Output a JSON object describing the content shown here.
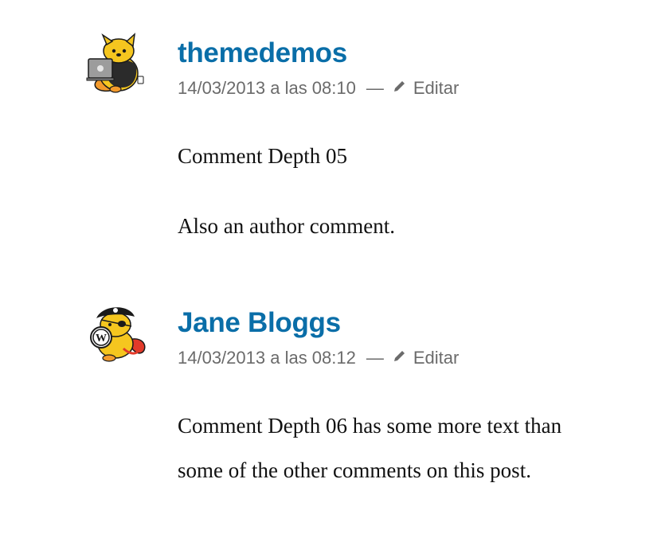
{
  "comments": [
    {
      "author": "themedemos",
      "date": "14/03/2013 a las 08:10",
      "separator": "—",
      "edit_label": "Editar",
      "paragraphs": [
        "Comment Depth 05",
        "Also an author comment."
      ]
    },
    {
      "author": "Jane Bloggs",
      "date": "14/03/2013 a las 08:12",
      "separator": "—",
      "edit_label": "Editar",
      "paragraphs": [
        "Comment Depth 06 has some more text than some of the other comments on this post."
      ]
    }
  ],
  "colors": {
    "author_link": "#0a6ea8",
    "meta_text": "#6b6b6b",
    "body_text": "#111111"
  },
  "icons": {
    "avatar_1": "wapuu-laptop-avatar",
    "avatar_2": "wapuu-pirate-avatar",
    "edit": "pencil-icon"
  }
}
